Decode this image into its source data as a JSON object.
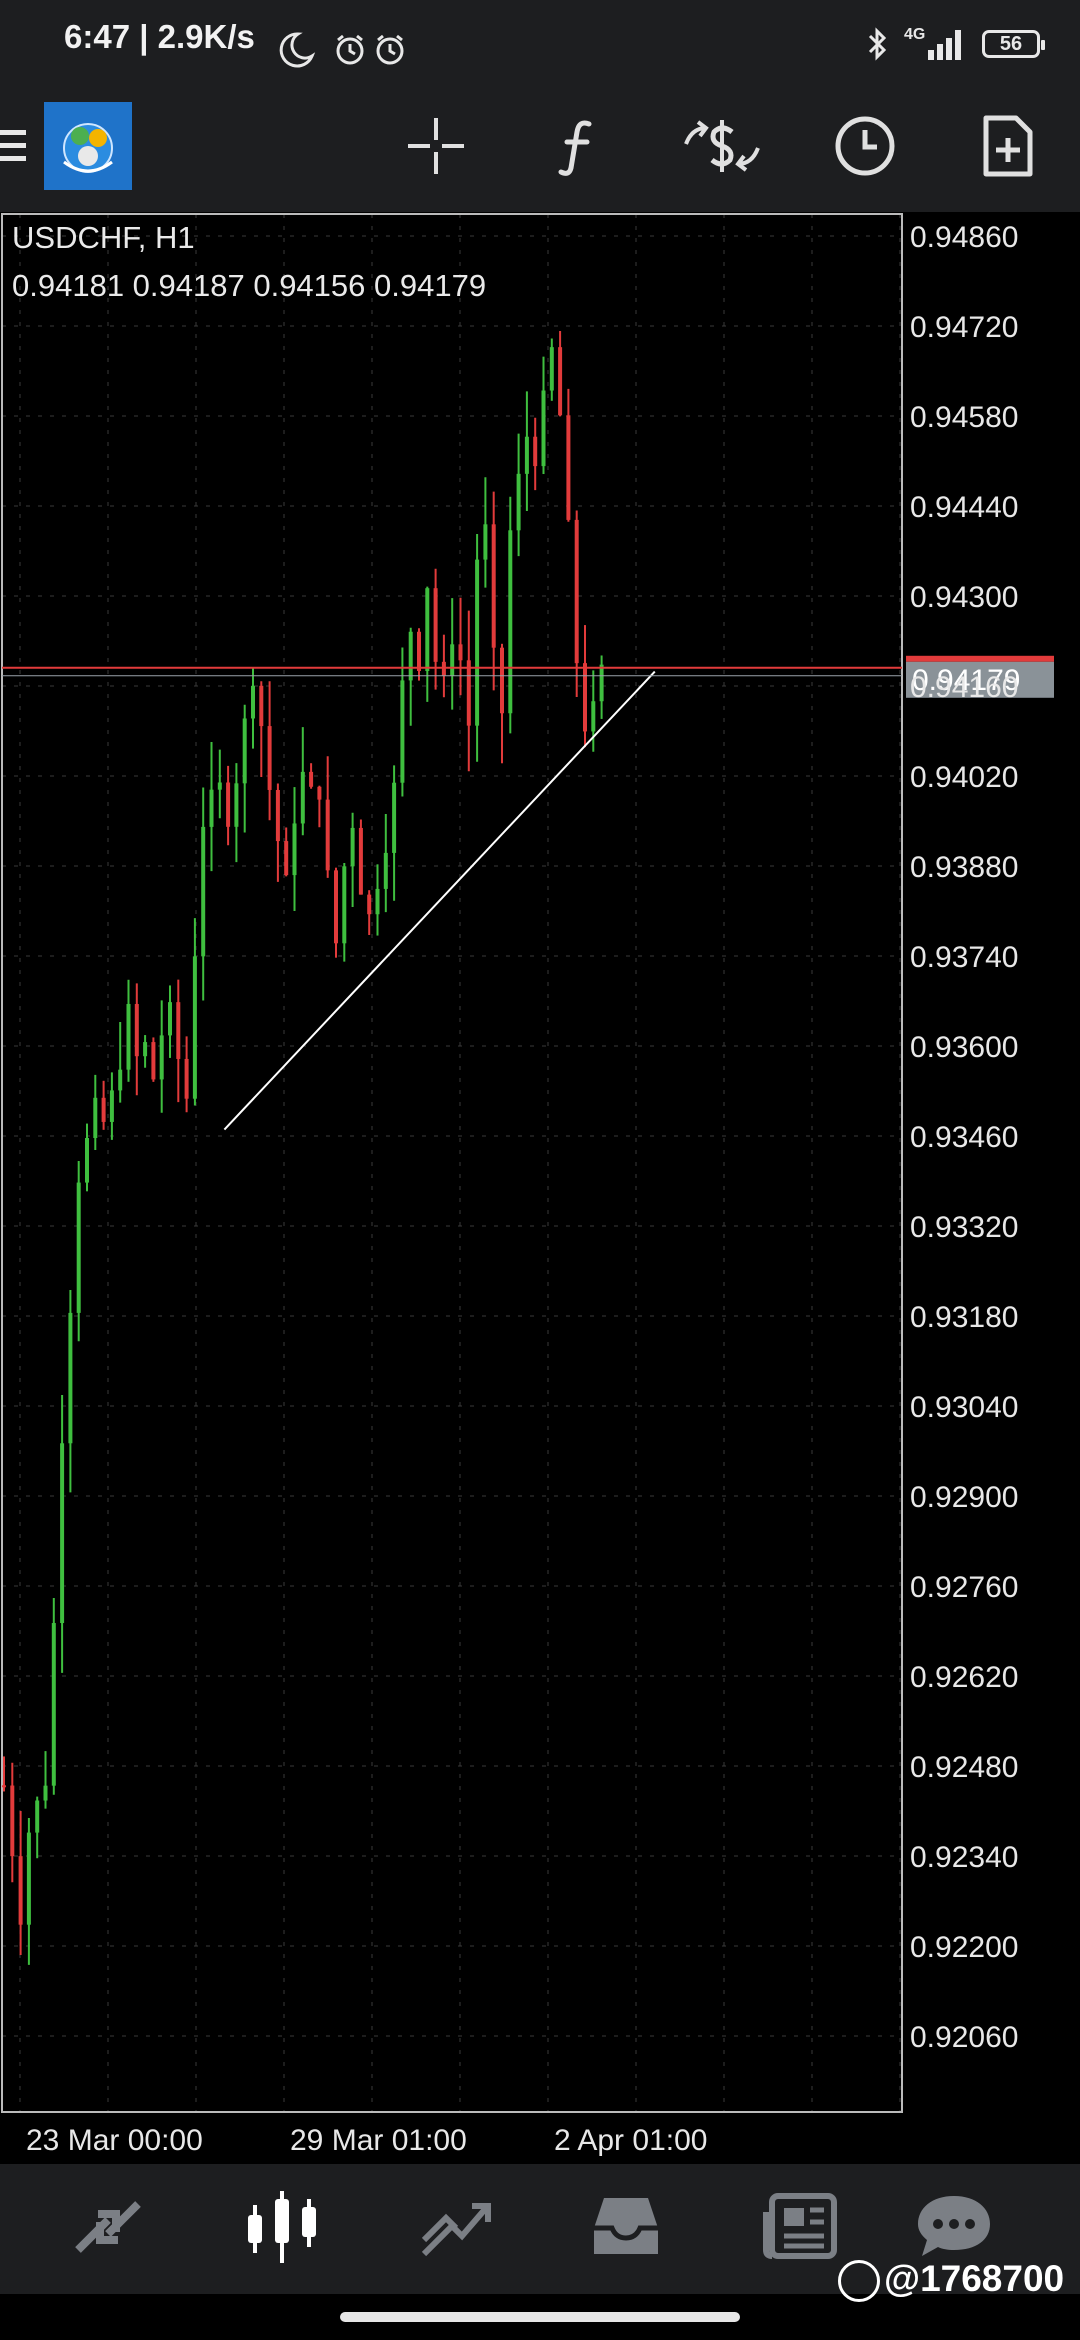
{
  "status_bar": {
    "time": "6:47",
    "network_speed": "2.9K/s",
    "signal_label": "4G",
    "battery_level": "56"
  },
  "toolbar": {
    "icons": [
      "menu-icon",
      "metatrader-logo",
      "crosshair-icon",
      "indicators-icon",
      "trade-icon",
      "clock-icon",
      "new-order-icon"
    ]
  },
  "chart": {
    "symbol": "USDCHF, H1",
    "ohlc": "0.94181 0.94187 0.94156 0.94179",
    "current_price_label": "0.94179",
    "price_axis": [
      "0.94860",
      "0.94720",
      "0.94580",
      "0.94440",
      "0.94300",
      "0.94160",
      "0.94020",
      "0.93880",
      "0.93740",
      "0.93600",
      "0.93460",
      "0.93320",
      "0.93180",
      "0.93040",
      "0.92900",
      "0.92760",
      "0.92620",
      "0.92480",
      "0.92340",
      "0.92200",
      "0.92060"
    ],
    "time_axis": [
      "23 Mar 00:00",
      "29 Mar 01:00",
      "2 Apr 01:00"
    ],
    "colors": {
      "bull": "#3fbf3f",
      "bear": "#e23b3b",
      "grid": "#3a3a3a",
      "ask_line": "#e23b3b",
      "bid_line": "#9aa3ab",
      "price_tag": "#8a9298"
    }
  },
  "chart_data": {
    "type": "candlestick",
    "title": "USDCHF, H1",
    "ylim": [
      0.9196,
      0.9491
    ],
    "price_ticks": [
      0.9486,
      0.9472,
      0.9458,
      0.9444,
      0.943,
      0.9416,
      0.9402,
      0.9388,
      0.9374,
      0.936,
      0.9346,
      0.9332,
      0.9318,
      0.9304,
      0.929,
      0.9276,
      0.9262,
      0.9248,
      0.9234,
      0.922,
      0.9206
    ],
    "x_tick_labels": [
      "23 Mar 00:00",
      "29 Mar 01:00",
      "2 Apr 01:00"
    ],
    "last_price": 0.94179,
    "close_path": [
      [
        0,
        0.9245
      ],
      [
        1,
        0.9235
      ],
      [
        2,
        0.9225
      ],
      [
        3,
        0.9238
      ],
      [
        4,
        0.9242
      ],
      [
        5,
        0.9246
      ],
      [
        6,
        0.927
      ],
      [
        7,
        0.93
      ],
      [
        8,
        0.932
      ],
      [
        9,
        0.934
      ],
      [
        10,
        0.9345
      ],
      [
        11,
        0.935
      ],
      [
        12,
        0.9348
      ],
      [
        13,
        0.9352
      ],
      [
        14,
        0.9358
      ],
      [
        15,
        0.9365
      ],
      [
        16,
        0.9358
      ],
      [
        17,
        0.936
      ],
      [
        18,
        0.9355
      ],
      [
        19,
        0.9362
      ],
      [
        20,
        0.9365
      ],
      [
        21,
        0.9358
      ],
      [
        22,
        0.9352
      ],
      [
        23,
        0.9375
      ],
      [
        24,
        0.9395
      ],
      [
        25,
        0.9398
      ],
      [
        26,
        0.94
      ],
      [
        27,
        0.9396
      ],
      [
        28,
        0.9402
      ],
      [
        29,
        0.941
      ],
      [
        30,
        0.9418
      ],
      [
        31,
        0.941
      ],
      [
        32,
        0.94
      ],
      [
        33,
        0.9392
      ],
      [
        34,
        0.9385
      ],
      [
        35,
        0.9396
      ],
      [
        36,
        0.9402
      ],
      [
        37,
        0.9399
      ],
      [
        38,
        0.94
      ],
      [
        39,
        0.9386
      ],
      [
        40,
        0.9376
      ],
      [
        41,
        0.9388
      ],
      [
        42,
        0.9395
      ],
      [
        43,
        0.9385
      ],
      [
        44,
        0.938
      ],
      [
        45,
        0.9386
      ],
      [
        46,
        0.9392
      ],
      [
        47,
        0.94
      ],
      [
        48,
        0.9416
      ],
      [
        49,
        0.9425
      ],
      [
        50,
        0.942
      ],
      [
        51,
        0.9432
      ],
      [
        52,
        0.942
      ],
      [
        53,
        0.9416
      ],
      [
        54,
        0.9424
      ],
      [
        55,
        0.942
      ],
      [
        56,
        0.941
      ],
      [
        57,
        0.9436
      ],
      [
        58,
        0.944
      ],
      [
        59,
        0.942
      ],
      [
        60,
        0.9412
      ],
      [
        61,
        0.944
      ],
      [
        62,
        0.9448
      ],
      [
        63,
        0.9455
      ],
      [
        64,
        0.9452
      ],
      [
        65,
        0.946
      ],
      [
        66,
        0.9468
      ],
      [
        67,
        0.9458
      ],
      [
        68,
        0.944
      ],
      [
        69,
        0.942
      ],
      [
        70,
        0.941
      ],
      [
        71,
        0.9412
      ],
      [
        72,
        0.9418
      ]
    ],
    "trendline": {
      "from": [
        8,
        0.9347
      ],
      "to": [
        76,
        0.9417
      ]
    }
  },
  "bottom_nav": {
    "items": [
      "quotes-icon",
      "chart-icon",
      "trade-icon",
      "history-icon",
      "news-icon",
      "chat-icon"
    ]
  },
  "watermark": "@1768700"
}
